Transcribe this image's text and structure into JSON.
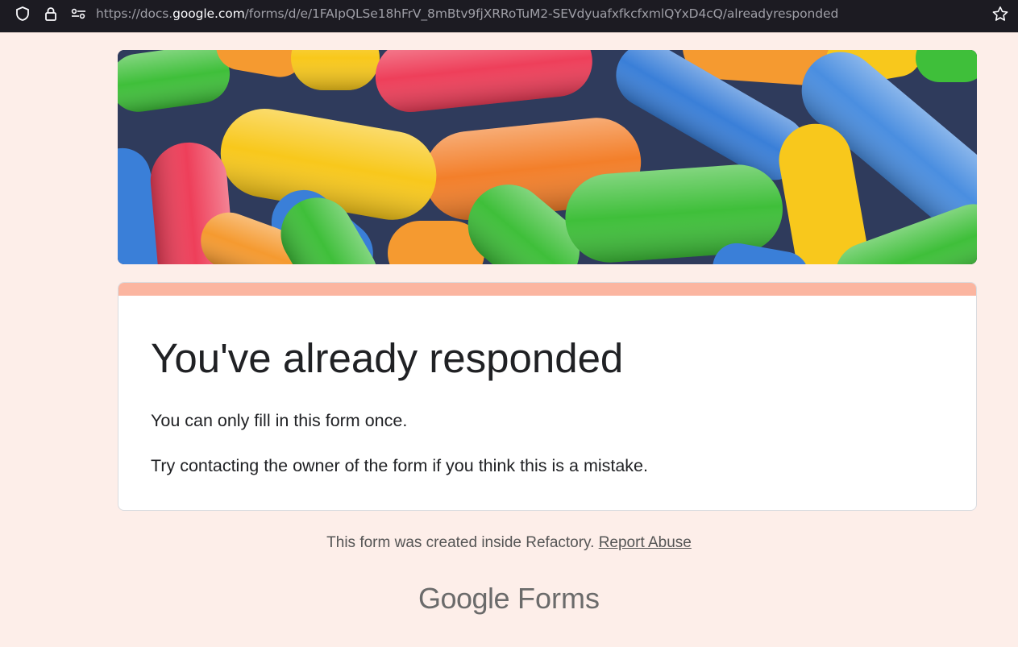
{
  "browser": {
    "url_prefix": "https://docs.",
    "url_host": "google.com",
    "url_path": "/forms/d/e/1FAIpQLSe18hFrV_8mBtv9fjXRRoTuM2-SEVdyuafxfkcfxmlQYxD4cQ/alreadyresponded",
    "icons": [
      "shield-icon",
      "lock-icon",
      "permissions-icon",
      "star-icon"
    ]
  },
  "banner": {
    "image": "candy-header-image"
  },
  "card": {
    "accent_color": "#fbb5a0",
    "title": "You've already responded",
    "line1": "You can only fill in this form once.",
    "line2": "Try contacting the owner of the form if you think this is a mistake."
  },
  "footer": {
    "text": "This form was created inside Refactory. ",
    "report_link": "Report Abuse",
    "logo_word1": "Google",
    "logo_word2": "Forms"
  },
  "colors": {
    "page_bg": "#fdeee9",
    "text": "#202124"
  }
}
